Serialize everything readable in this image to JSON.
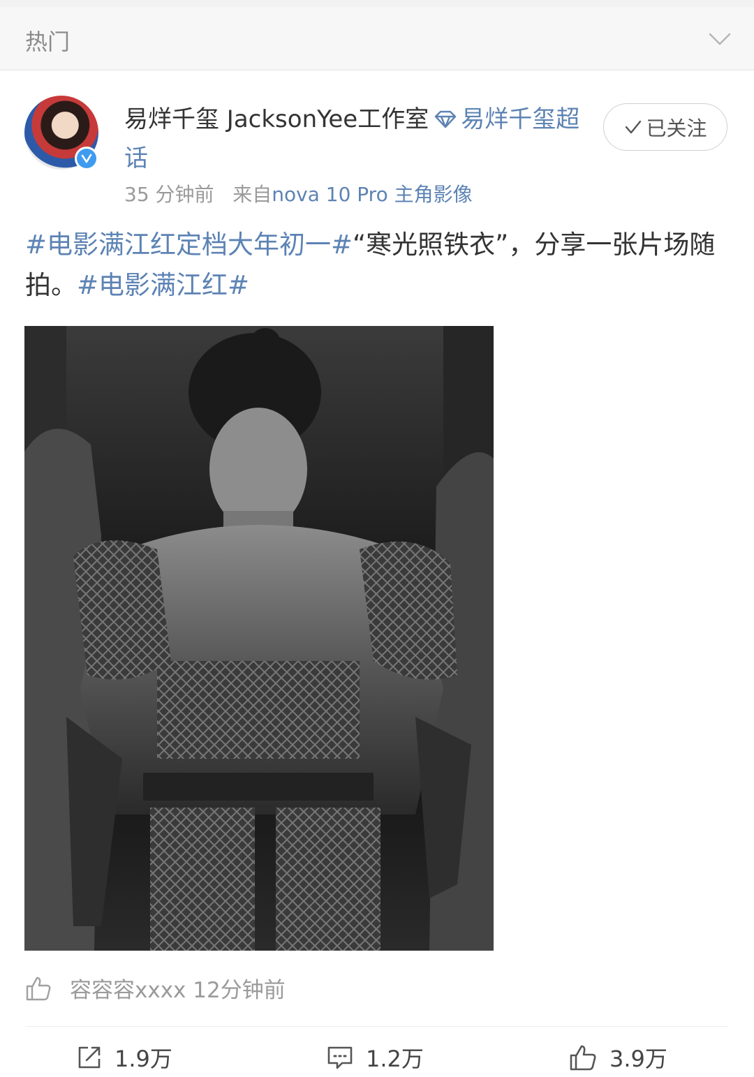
{
  "header": {
    "title": "热门",
    "icon": "chevron-down-icon"
  },
  "post": {
    "author": "易烊千玺 JacksonYee工作室",
    "supertopic": "易烊千玺超话",
    "follow_label": "已关注",
    "time": "35 分钟前",
    "from_label": "来自",
    "source": "nova 10 Pro 主角影像",
    "text": {
      "hashtag1": "#电影满江红定档大年初一#",
      "body": "“寒光照铁衣”，分享一张片场随拍。",
      "hashtag2": "#电影满江红#"
    },
    "liked_by": {
      "user": "容容容xxxx",
      "time": "12分钟前"
    },
    "actions": {
      "repost": "1.9万",
      "comment": "1.2万",
      "like": "3.9万"
    }
  },
  "colors": {
    "link": "#5d83b4",
    "verified": "#3f9bf0",
    "text": "#333333",
    "muted": "#9a9a9a"
  }
}
